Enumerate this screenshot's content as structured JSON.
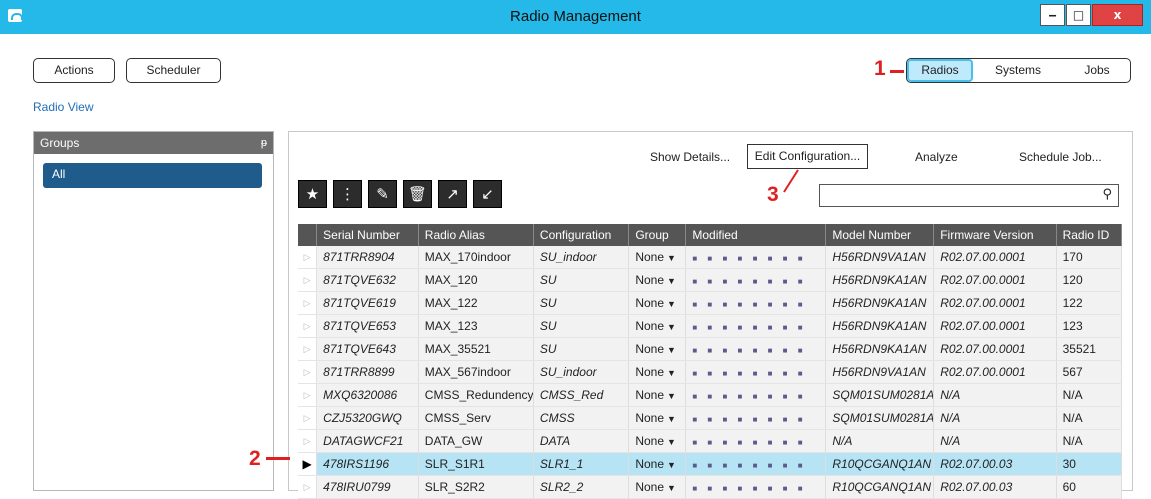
{
  "window": {
    "title": "Radio Management"
  },
  "header": {
    "actions_label": "Actions",
    "scheduler_label": "Scheduler"
  },
  "view_tabs": [
    {
      "label": "Radios",
      "active": true
    },
    {
      "label": "Systems"
    },
    {
      "label": "Jobs"
    }
  ],
  "breadcrumb": "Radio View",
  "groups": {
    "title": "Groups",
    "items": [
      "All"
    ]
  },
  "panel_actions": {
    "show_details": "Show Details...",
    "edit_configuration": "Edit Configuration...",
    "analyze": "Analyze",
    "schedule_job": "Schedule Job..."
  },
  "search": {
    "value": ""
  },
  "annotations": {
    "mark1": "1",
    "mark2": "2",
    "mark3": "3"
  },
  "toolbar_icons": [
    "favorite-icon",
    "more-icon",
    "edit-icon",
    "delete-icon",
    "open-external-icon",
    "export-icon"
  ],
  "table": {
    "columns": [
      "Serial Number",
      "Radio Alias",
      "Configuration",
      "Group",
      "Modified",
      "Model Number",
      "Firmware Version",
      "Radio ID"
    ],
    "rows": [
      {
        "serial": "871TRR8904",
        "alias": "MAX_170indoor",
        "config": "SU_indoor",
        "group": "None",
        "model": "H56RDN9VA1AN",
        "firmware": "R02.07.00.0001",
        "radio_id": "170"
      },
      {
        "serial": "871TQVE632",
        "alias": "MAX_120",
        "config": "SU",
        "group": "None",
        "model": "H56RDN9KA1AN",
        "firmware": "R02.07.00.0001",
        "radio_id": "120"
      },
      {
        "serial": "871TQVE619",
        "alias": "MAX_122",
        "config": "SU",
        "group": "None",
        "model": "H56RDN9KA1AN",
        "firmware": "R02.07.00.0001",
        "radio_id": "122"
      },
      {
        "serial": "871TQVE653",
        "alias": "MAX_123",
        "config": "SU",
        "group": "None",
        "model": "H56RDN9KA1AN",
        "firmware": "R02.07.00.0001",
        "radio_id": "123"
      },
      {
        "serial": "871TQVE643",
        "alias": "MAX_35521",
        "config": "SU",
        "group": "None",
        "model": "H56RDN9KA1AN",
        "firmware": "R02.07.00.0001",
        "radio_id": "35521"
      },
      {
        "serial": "871TRR8899",
        "alias": "MAX_567indoor",
        "config": "SU_indoor",
        "group": "None",
        "model": "H56RDN9VA1AN",
        "firmware": "R02.07.00.0001",
        "radio_id": "567"
      },
      {
        "serial": "MXQ6320086",
        "alias": "CMSS_Redundency",
        "config": "CMSS_Red",
        "group": "None",
        "model": "SQM01SUM0281A",
        "firmware": "N/A",
        "radio_id": "N/A"
      },
      {
        "serial": "CZJ5320GWQ",
        "alias": "CMSS_Serv",
        "config": "CMSS",
        "group": "None",
        "model": "SQM01SUM0281A",
        "firmware": "N/A",
        "radio_id": "N/A"
      },
      {
        "serial": "DATAGWCF21",
        "alias": "DATA_GW",
        "config": "DATA",
        "group": "None",
        "model": "N/A",
        "firmware": "N/A",
        "radio_id": "N/A"
      },
      {
        "serial": "478IRS1196",
        "alias": "SLR_S1R1",
        "config": "SLR1_1",
        "group": "None",
        "model": "R10QCGANQ1AN",
        "firmware": "R02.07.00.03",
        "radio_id": "30",
        "selected": true
      },
      {
        "serial": "478IRU0799",
        "alias": "SLR_S2R2",
        "config": "SLR2_2",
        "group": "None",
        "model": "R10QCGANQ1AN",
        "firmware": "R02.07.00.03",
        "radio_id": "60"
      }
    ]
  }
}
